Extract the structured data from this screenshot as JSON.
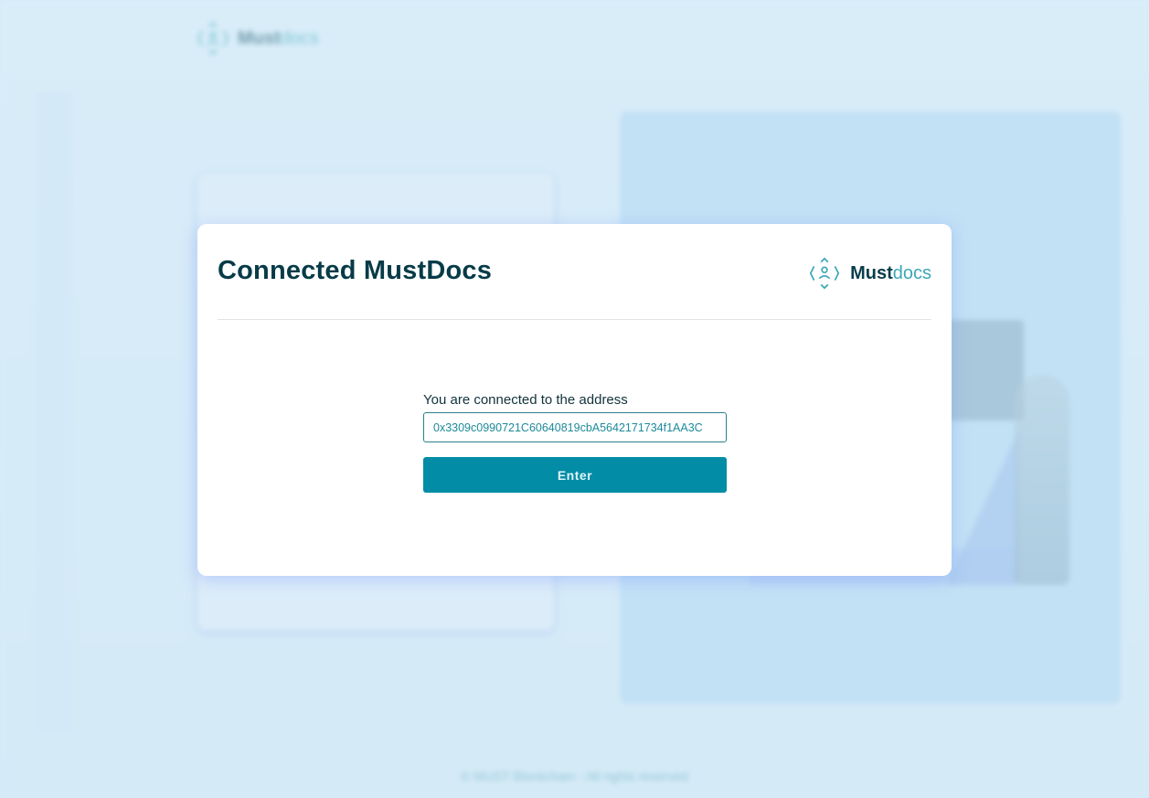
{
  "background": {
    "logo": {
      "text_main": "Must",
      "text_accent": "docs"
    },
    "footer": "© MUST Blockchain - All rights reserved"
  },
  "modal": {
    "title": "Connected MustDocs",
    "logo": {
      "text_main": "Must",
      "text_accent": "docs"
    },
    "label": "You are connected to the address",
    "address": "0x3309c0990721C60640819cbA5642171734f1AA3C",
    "enter_label": "Enter"
  },
  "colors": {
    "primary": "#028ca6",
    "title": "#073b48",
    "accent": "#3ca7b8",
    "overlay": "#d5ebf8"
  }
}
